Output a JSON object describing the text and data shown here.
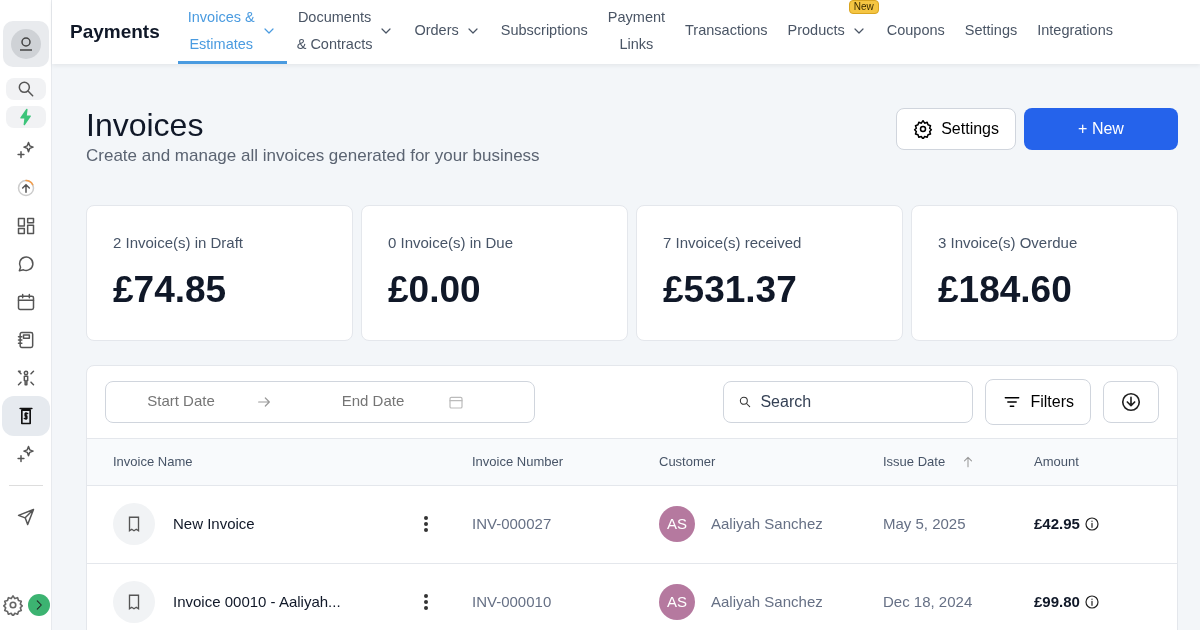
{
  "app_title": "Payments",
  "nav": [
    {
      "label": "Invoices &\nEstimates",
      "dropdown": true,
      "selected": true
    },
    {
      "label": "Documents\n& Contracts",
      "dropdown": true,
      "selected": false
    },
    {
      "label": "Orders",
      "dropdown": true,
      "selected": false
    },
    {
      "label": "Subscriptions",
      "dropdown": false,
      "selected": false
    },
    {
      "label": "Payment\nLinks",
      "dropdown": false,
      "selected": false
    },
    {
      "label": "Transactions",
      "dropdown": false,
      "selected": false
    },
    {
      "label": "Products",
      "dropdown": true,
      "selected": false,
      "badge": "New"
    },
    {
      "label": "Coupons",
      "dropdown": false,
      "selected": false
    },
    {
      "label": "Settings",
      "dropdown": false,
      "selected": false
    },
    {
      "label": "Integrations",
      "dropdown": false,
      "selected": false
    }
  ],
  "sidebar": [
    {
      "kind": "search",
      "selected": false
    },
    {
      "kind": "bolt",
      "selected": false
    },
    {
      "kind": "sparkle",
      "selected": false
    },
    {
      "kind": "upload",
      "selected": false
    },
    {
      "kind": "grid",
      "selected": false
    },
    {
      "kind": "chat",
      "selected": false
    },
    {
      "kind": "calendar",
      "selected": false
    },
    {
      "kind": "notebook",
      "selected": false
    },
    {
      "kind": "people",
      "selected": false
    },
    {
      "kind": "dollar",
      "selected": true
    },
    {
      "kind": "sparkle",
      "selected": false
    },
    {
      "kind": "divider"
    },
    {
      "kind": "send",
      "selected": false
    }
  ],
  "page": {
    "title": "Invoices",
    "subtitle": "Create and manage all invoices generated for your business",
    "settings_button": "Settings",
    "new_button": "+ New"
  },
  "stats": [
    {
      "label": "2 Invoice(s) in Draft",
      "value": "£74.85"
    },
    {
      "label": "0 Invoice(s) in Due",
      "value": "£0.00"
    },
    {
      "label": "7 Invoice(s) received",
      "value": "£531.37"
    },
    {
      "label": "3 Invoice(s) Overdue",
      "value": "£184.60"
    }
  ],
  "toolbar": {
    "start_placeholder": "Start Date",
    "end_placeholder": "End Date",
    "search_placeholder": "Search",
    "filters_button": "Filters"
  },
  "table": {
    "columns": [
      "Invoice Name",
      "Invoice Number",
      "Customer",
      "Issue Date",
      "Amount"
    ],
    "rows": [
      {
        "name": "New Invoice",
        "number": "INV-000027",
        "initials": "AS",
        "customer": "Aaliyah Sanchez",
        "date": "May 5, 2025",
        "amount": "£42.95"
      },
      {
        "name": "Invoice 00010 - Aaliyah...",
        "number": "INV-000010",
        "initials": "AS",
        "customer": "Aaliyah Sanchez",
        "date": "Dec 18, 2024",
        "amount": "£99.80"
      }
    ]
  }
}
